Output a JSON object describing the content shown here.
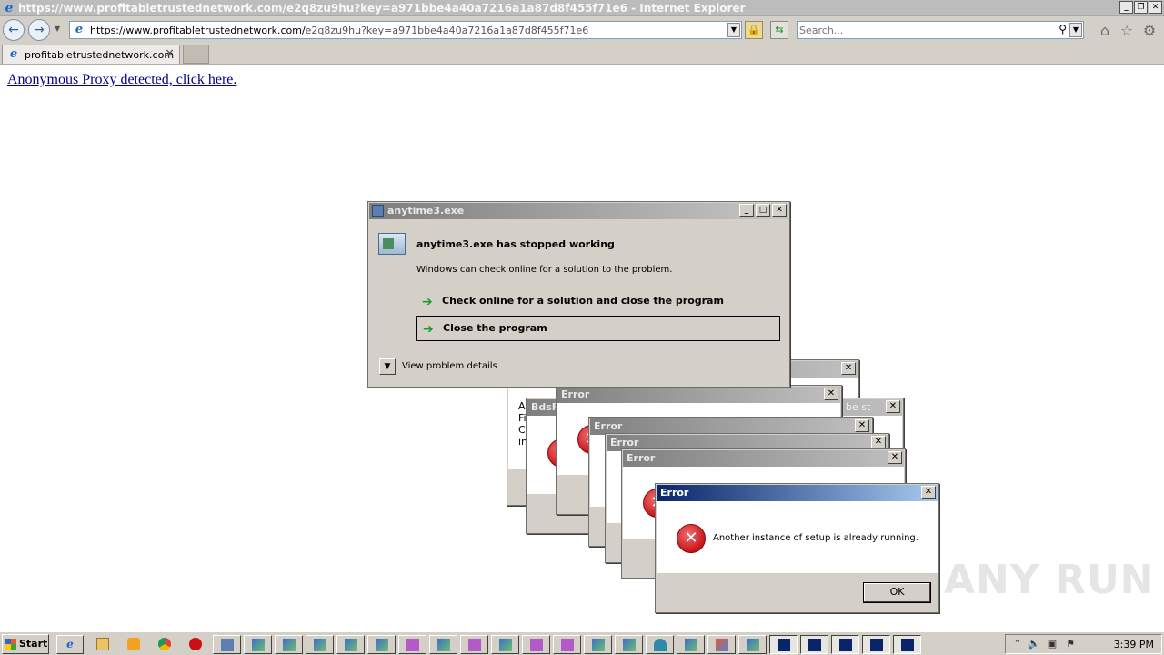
{
  "browser": {
    "window_title": "https://www.profitabletrustednetwork.com/e2q8zu9hu?key=a971bbe4a40a7216a1a87d8f455f71e6 - Internet Explorer",
    "address_prefix": "https://www.profitabletrustednetwork.com/",
    "address_path": "e2q8zu9hu?key=a971bbe4a40a7216a1a87d8f455f71e6",
    "search_placeholder": "Search...",
    "tab_label": "profitabletrustednetwork.com",
    "window_buttons": {
      "minimize": "_",
      "maximize": "❐",
      "close": "✕"
    }
  },
  "page": {
    "link_text": "Anonymous Proxy detected, click here."
  },
  "stopped_dialog": {
    "title": "anytime3.exe",
    "heading": "anytime3.exe has stopped working",
    "description": "Windows can check online for a solution to the problem.",
    "option_check": "Check online for a solution and close the program",
    "option_close": "Close the program",
    "details_label": "View problem details"
  },
  "background_dialogs": {
    "titles": [
      "BdsF",
      "Error",
      "Error",
      "Error",
      "Error"
    ],
    "fragment_title": "be st",
    "fragments": [
      "A",
      "Fi",
      "C",
      "in"
    ]
  },
  "error_dialog": {
    "title": "Error",
    "message": "Another instance of setup is already running.",
    "ok_label": "OK"
  },
  "watermark": "ANY RUN",
  "taskbar": {
    "start_label": "Start",
    "clock": "3:39 PM"
  },
  "colors": {
    "link": "#00008b",
    "active_title_start": "#0a246a",
    "active_title_end": "#a6caf0",
    "error_red": "#c8151b",
    "arrow_green": "#1d9b33"
  }
}
